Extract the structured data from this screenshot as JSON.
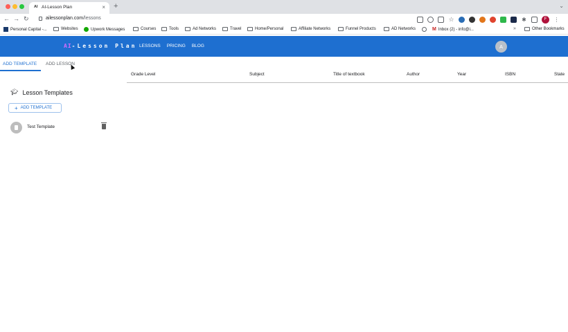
{
  "browser": {
    "tab": {
      "favicon_text": "AI",
      "title": "AI-Lesson Plan",
      "close": "×"
    },
    "new_tab": "+",
    "tabstrip_menu": "⌄",
    "nav": {
      "back": "←",
      "forward": "→",
      "reload": "↻"
    },
    "url_host": "ailessonplan.com",
    "url_path": "/lessons",
    "profile_initial": "F",
    "bookmarks": [
      "Personal Capital -...",
      "Websites",
      "Upwork Messages",
      "Courses",
      "Tools",
      "Ad Networks",
      "Travel",
      "Home/Personal",
      "Affiliate Networks",
      "Funnel Products",
      "AD Networks",
      "Inbox (2) - info@i..."
    ],
    "bookmarks_more": "»",
    "other_bookmarks": "Other Bookmarks"
  },
  "app": {
    "logo_prefix": "AI",
    "logo_rest": "-Lesson Plan",
    "nav": [
      "LESSONS",
      "PRICING",
      "BLOG"
    ],
    "avatar_initial": "A"
  },
  "page_tabs": [
    "ADD TEMPLATE",
    "ADD LESSON"
  ],
  "table": {
    "columns": [
      "Grade Level",
      "Subject",
      "Title of textbook",
      "Author",
      "Year",
      "ISBN",
      "State"
    ]
  },
  "templates_panel": {
    "title": "Lesson Templates",
    "add_button": "ADD TEMPLATE",
    "items": [
      {
        "name": "Test Template"
      }
    ]
  },
  "colors": {
    "accent": "#1e6fd0",
    "logo_highlight": "#d56cff",
    "tab_strip": "#dfe1e5"
  }
}
